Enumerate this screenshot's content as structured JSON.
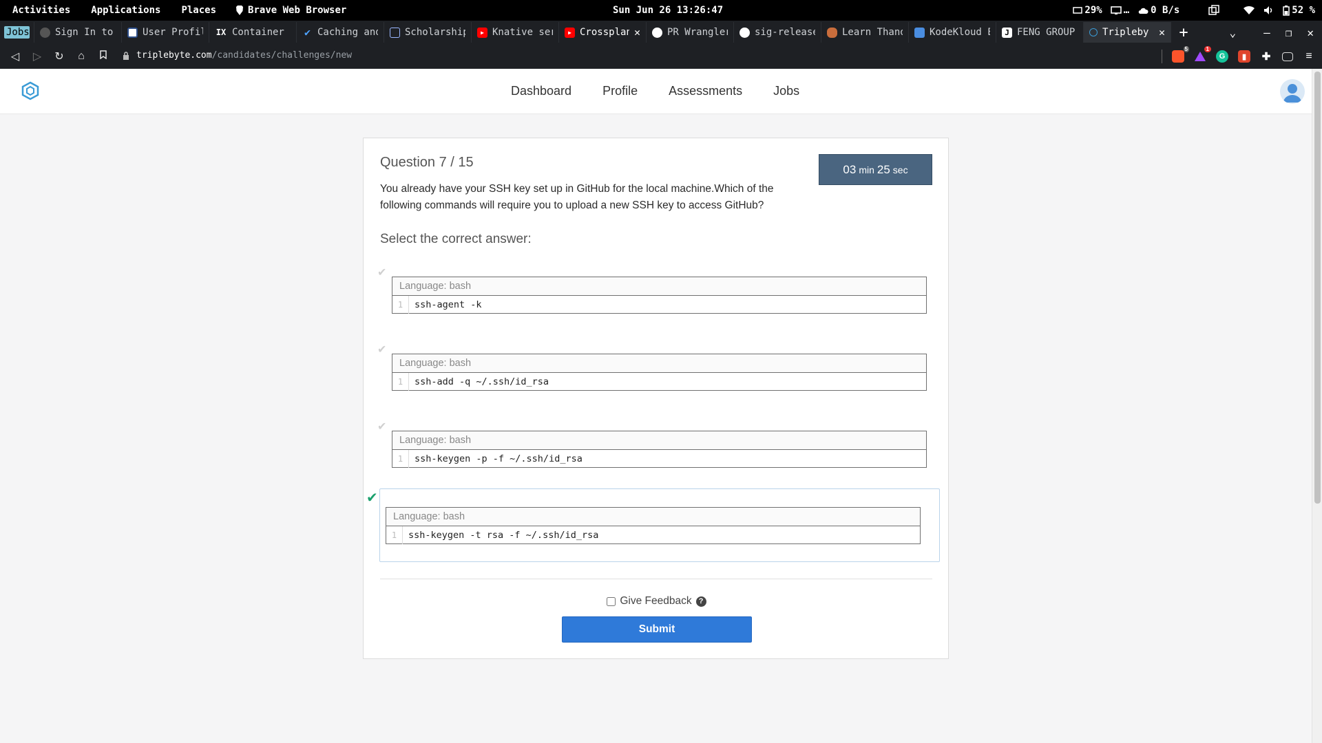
{
  "system": {
    "activities": "Activities",
    "applications": "Applications",
    "places": "Places",
    "app_name": "Brave Web Browser",
    "clock": "Sun Jun 26 13:26:47",
    "cpu": "29%",
    "display": "…",
    "net": "0 B/s",
    "battery": "52 %"
  },
  "tabs": [
    {
      "title": "Jobs",
      "favicon": "jobs-badge"
    },
    {
      "title": "Sign In to",
      "favicon": "globe-icon"
    },
    {
      "title": "User Profil",
      "favicon": "profile-icon"
    },
    {
      "title": "Container N",
      "favicon": "ix-icon",
      "fav_text": "IX"
    },
    {
      "title": "Caching and",
      "favicon": "check-icon"
    },
    {
      "title": "Scholarship",
      "favicon": "scholarship-icon"
    },
    {
      "title": "Knative ser",
      "favicon": "youtube-icon"
    },
    {
      "title": "Crossplan",
      "favicon": "youtube-icon"
    },
    {
      "title": "PR Wrangler",
      "favicon": "github-icon"
    },
    {
      "title": "sig-release",
      "favicon": "github-icon"
    },
    {
      "title": "Learn Thano",
      "favicon": "lips-icon"
    },
    {
      "title": "KodeKloud E",
      "favicon": "kodekloud-icon"
    },
    {
      "title": "FENG GROUP",
      "favicon": "j-icon"
    },
    {
      "title": "Tripleby",
      "favicon": "triplebyte-icon"
    }
  ],
  "address": {
    "host": "triplebyte.com",
    "path": "/candidates/challenges/new"
  },
  "extensions": {
    "brave_shield_count": "5",
    "rewards_count": "1"
  },
  "nav": {
    "links": [
      "Dashboard",
      "Profile",
      "Assessments",
      "Jobs"
    ]
  },
  "question": {
    "number": "Question 7 / 15",
    "text": "You already have your SSH key set up in GitHub for the local machine.Which of the following commands will require you to upload a new SSH key to access GitHub?",
    "timer_min": "03",
    "timer_min_unit": "min",
    "timer_sec": "25",
    "timer_sec_unit": "sec",
    "select_label": "Select the correct answer:",
    "options": [
      {
        "language": "Language: bash",
        "line_no": "1",
        "code": "ssh-agent -k",
        "selected": false
      },
      {
        "language": "Language: bash",
        "line_no": "1",
        "code": "ssh-add -q ~/.ssh/id_rsa",
        "selected": false
      },
      {
        "language": "Language: bash",
        "line_no": "1",
        "code": "ssh-keygen -p -f ~/.ssh/id_rsa",
        "selected": false
      },
      {
        "language": "Language: bash",
        "line_no": "1",
        "code": "ssh-keygen -t rsa -f ~/.ssh/id_rsa",
        "selected": true
      }
    ],
    "feedback_label": "Give Feedback",
    "help_glyph": "?",
    "submit_label": "Submit"
  },
  "colors": {
    "timer_bg": "#4a6580",
    "submit_bg": "#2f7ad9",
    "selected_check": "#1aa06d"
  }
}
